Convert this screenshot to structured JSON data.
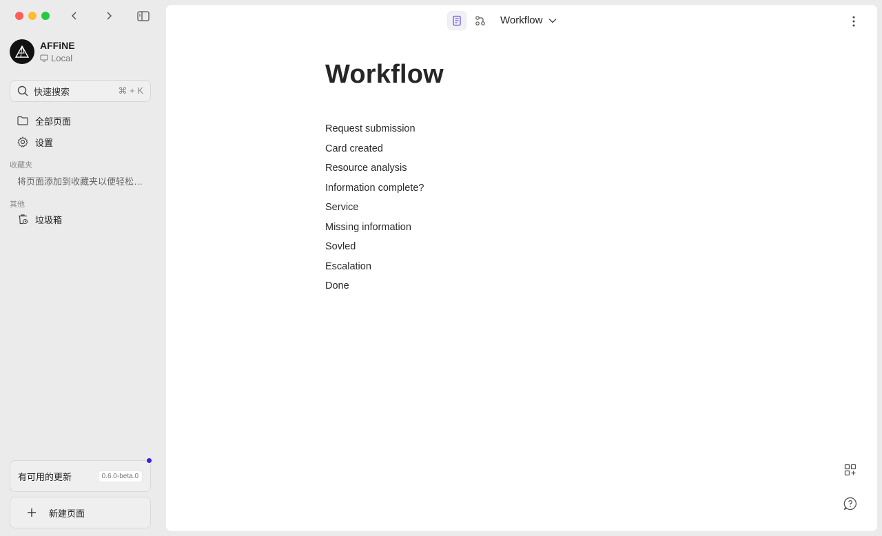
{
  "sidebar": {
    "workspace": {
      "name": "AFFiNE",
      "storage": "Local"
    },
    "search": {
      "label": "快速搜索",
      "shortcut": "⌘ + K"
    },
    "items": [
      {
        "label": "全部页面",
        "icon": "folder-icon"
      },
      {
        "label": "设置",
        "icon": "gear-icon"
      }
    ],
    "favorites": {
      "title": "收藏夹",
      "empty_hint": "将页面添加到收藏夹以便轻松访问"
    },
    "others": {
      "title": "其他",
      "trash_label": "垃圾箱"
    },
    "update": {
      "label": "有可用的更新",
      "version": "0.6.0-beta.0"
    },
    "new_page_label": "新建页面"
  },
  "header": {
    "doc_title": "Workflow",
    "modes": [
      "page-mode-icon",
      "edgeless-mode-icon"
    ],
    "active_mode": "page"
  },
  "document": {
    "title": "Workflow",
    "blocks": [
      "Request submission",
      "Card created",
      "Resource analysis",
      "Information complete?",
      "Service",
      "Missing information",
      "Sovled",
      "Escalation",
      "Done"
    ]
  },
  "colors": {
    "accent": "#3a1ee8",
    "mode_active": "#6b55e0",
    "sidebar_bg": "#ebebeb",
    "main_bg": "#ffffff"
  }
}
